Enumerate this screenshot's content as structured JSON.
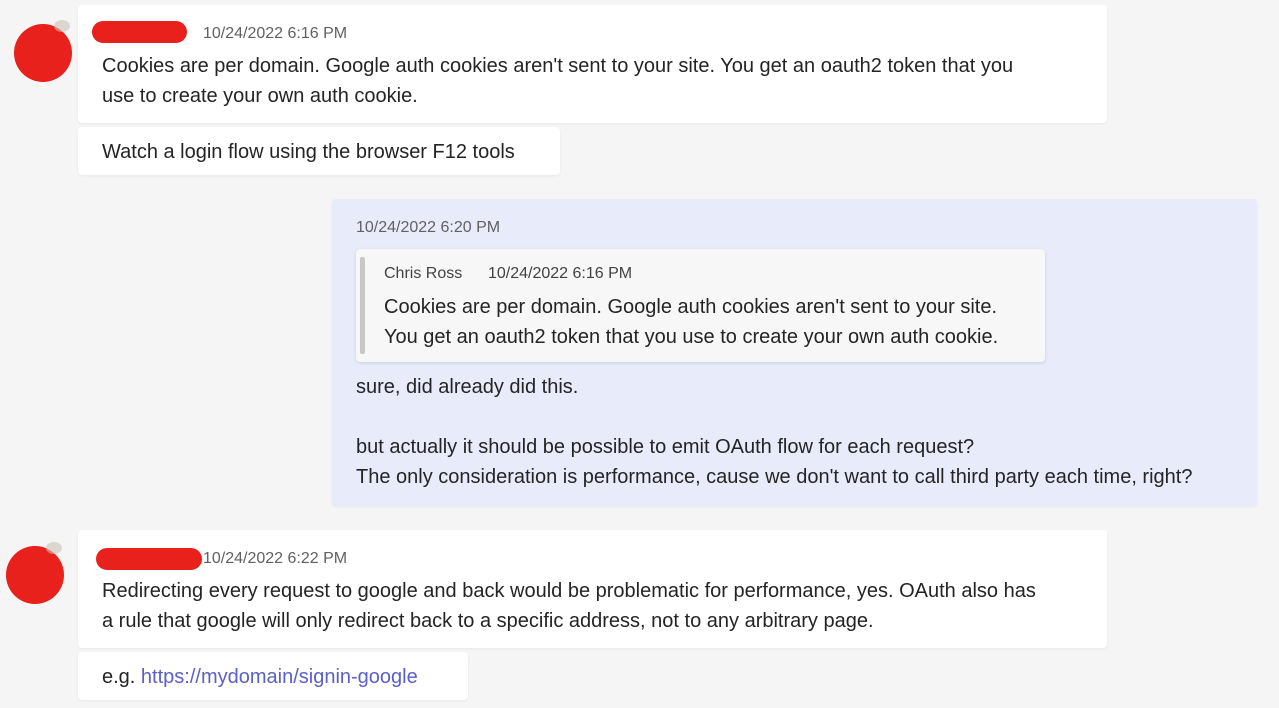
{
  "colors": {
    "background": "#f5f5f5",
    "bubble": "#ffffff",
    "my_bubble": "#e8ebfa",
    "link": "#5b5fc7",
    "redaction": "#e8211c"
  },
  "messages": [
    {
      "timestamp": "10/24/2022 6:16 PM",
      "text_line1": "Cookies are per domain. Google auth cookies aren't sent to your site. You get an oauth2 token that you",
      "text_line2": "use to create your own auth cookie.",
      "followup": "Watch a login flow using the browser F12 tools"
    },
    {
      "timestamp": "10/24/2022 6:20 PM",
      "quote": {
        "author": "Chris Ross",
        "timestamp": "10/24/2022 6:16 PM",
        "line1": "Cookies are per domain. Google auth cookies aren't sent to your site.",
        "line2": "You get an oauth2 token that you use to create your own auth cookie."
      },
      "line1": "sure, did already did this.",
      "line2": "but actually it should be possible to emit OAuth flow for each request?",
      "line3": "The only consideration is performance, cause we don't want to call third party each time, right?"
    },
    {
      "timestamp": "10/24/2022 6:22 PM",
      "text_line1": "Redirecting every request to google and back would be problematic for performance, yes. OAuth also has",
      "text_line2": "a rule that google will only redirect back to a specific address, not to any arbitrary page.",
      "followup_prefix": "e.g. ",
      "followup_link": "https://mydomain/signin-google"
    }
  ]
}
